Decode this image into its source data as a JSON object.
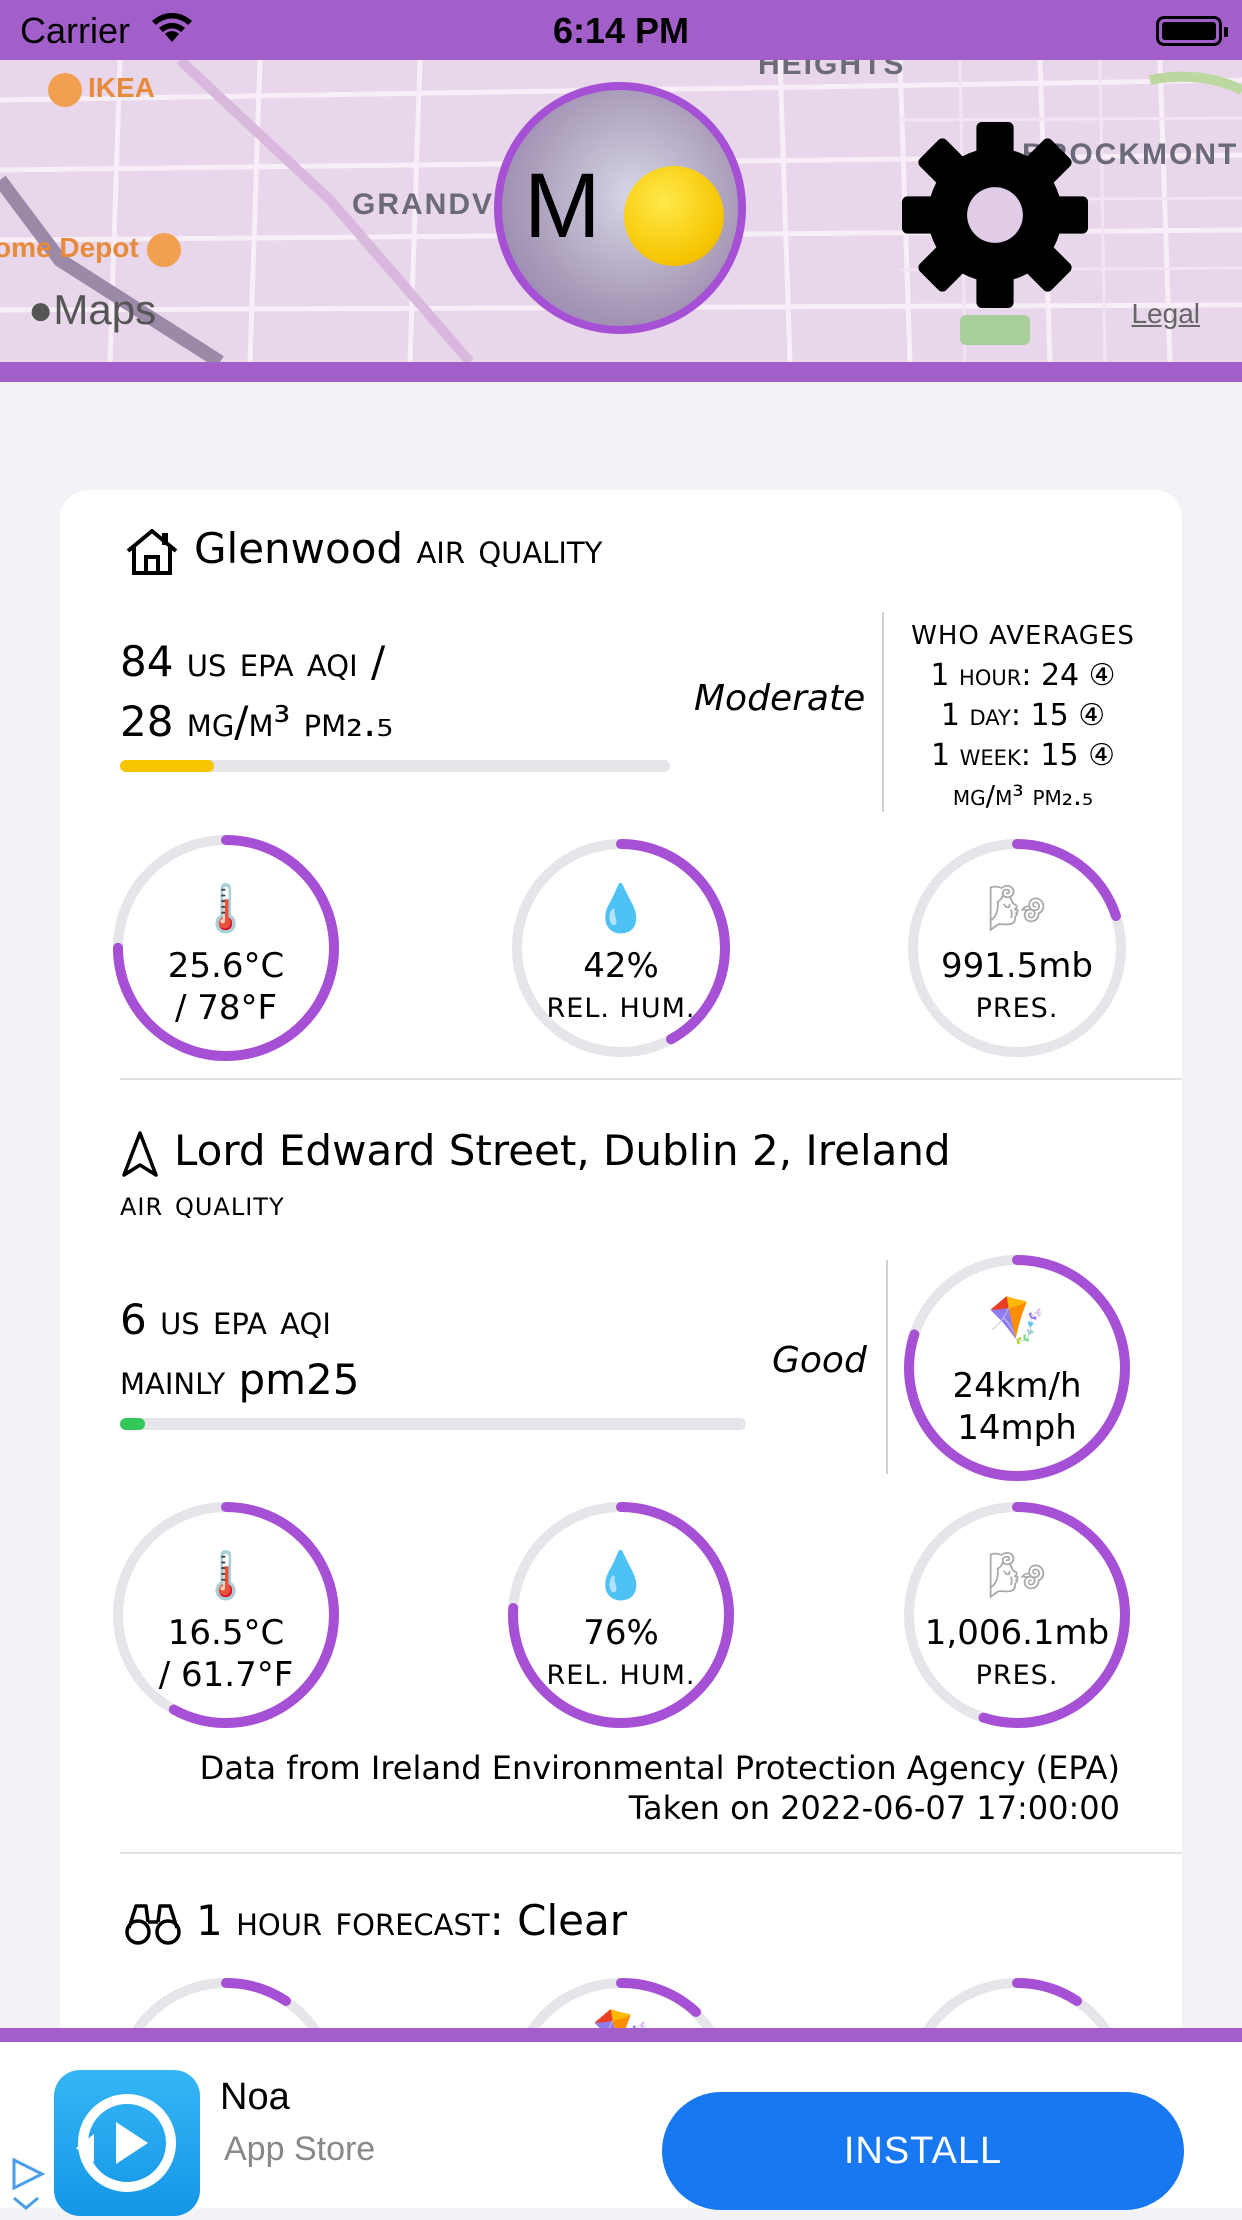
{
  "status_bar": {
    "carrier": "Carrier",
    "time": "6:14 PM"
  },
  "map": {
    "labels": {
      "heights": "HEIGHTS",
      "brockmont": "BROCKMONT",
      "grandview": "GRANDVIE"
    },
    "pois": {
      "ikea": "IKEA",
      "home_depot": "ome Depot"
    },
    "brand": "Maps",
    "legal": "Legal"
  },
  "header": {
    "moon_letter": "M"
  },
  "home": {
    "location": "Glenwood",
    "title_suffix": "air quality",
    "aqi_line1": "84 us epa aqi /",
    "aqi_line2": "28 μg/m³ pm₂.₅",
    "category": "Moderate",
    "aqi_fraction": 0.17,
    "aqi_color": "#f6c500",
    "who": {
      "heading": "WHO AVERAGES",
      "hour": "1 hour: 24 ④",
      "day": "1 day: 15 ④",
      "week": "1 week: 15 ④",
      "unit": "μg/m³ pm₂.₅"
    },
    "temp": {
      "line1": "25.6°C",
      "line2": "/ 78°F",
      "fraction": 0.75
    },
    "humidity": {
      "value": "42%",
      "label": "REL. HUM.",
      "fraction": 0.42
    },
    "pressure": {
      "value": "991.5mb",
      "label": "PRES.",
      "fraction": 0.2
    }
  },
  "current": {
    "location": "Lord Edward Street, Dublin 2, Ireland",
    "subtitle": "air quality",
    "aqi_line1": "6 us epa aqi",
    "aqi_line2_prefix": "mainly",
    "aqi_line2_value": "pm25",
    "category": "Good",
    "aqi_fraction": 0.04,
    "aqi_color": "#34c759",
    "wind": {
      "kmh": "24km/h",
      "mph": "14mph",
      "fraction": 0.8
    },
    "temp": {
      "line1": "16.5°C",
      "line2": "/ 61.7°F",
      "fraction": 0.58
    },
    "humidity": {
      "value": "76%",
      "label": "REL. HUM.",
      "fraction": 0.76
    },
    "pressure": {
      "value": "1,006.1mb",
      "label": "PRES.",
      "fraction": 0.55
    },
    "credit_source": "Data from Ireland Environmental Protection Agency (EPA)",
    "credit_time": "Taken on 2022-06-07 17:00:00"
  },
  "forecast": {
    "prefix": "1 hour forecast:",
    "condition": "Clear"
  },
  "ad": {
    "app_name": "Noa",
    "store": "App Store",
    "install_label": "INSTALL"
  },
  "colors": {
    "accent": "#a650d6",
    "gauge_track": "#e5e5ea"
  }
}
